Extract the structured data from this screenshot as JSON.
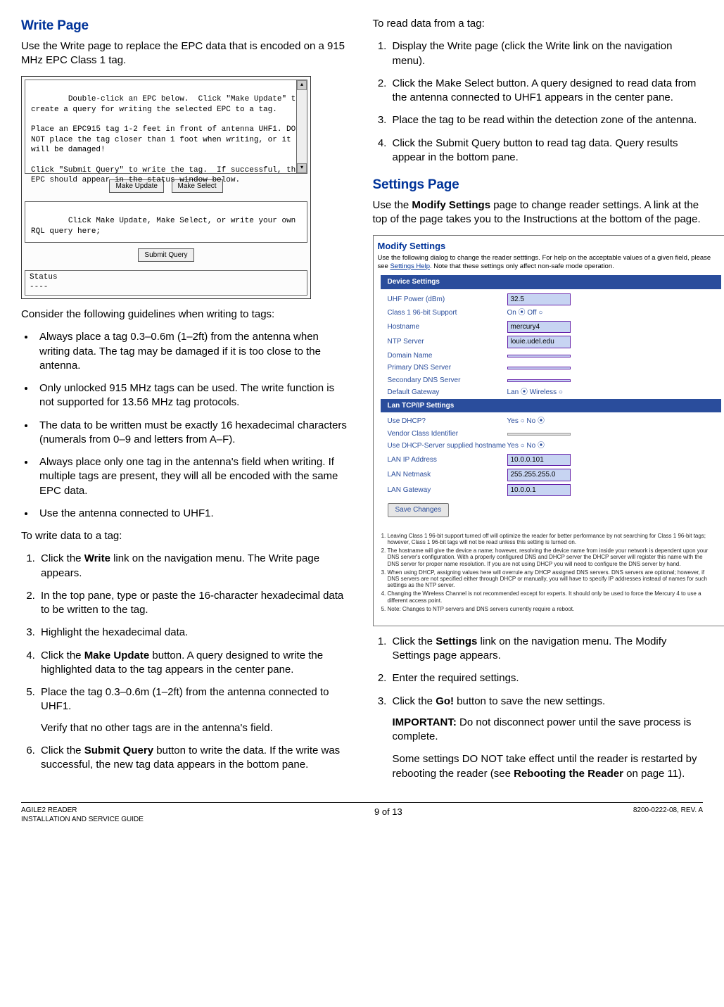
{
  "left": {
    "h_write": "Write Page",
    "intro_write": "Use the Write page to replace the EPC data that is encoded on a 915 MHz EPC Class 1 tag.",
    "fig1_top": "Double-click an EPC below.  Click \"Make Update\" to create a query for writing the selected EPC to a tag.\n\nPlace an EPC915 tag 1-2 feet in front of antenna UHF1. DO NOT place the tag closer than 1 foot when writing, or it will be damaged!\n\nClick \"Submit Query\" to write the tag.  If successful, the EPC should appear in the status window below.",
    "btn_make_update": "Make Update",
    "btn_make_select": "Make Select",
    "fig1_mid": "Click Make Update, Make Select, or write your own RQL query here;",
    "btn_submit_query": "Submit Query",
    "status_label": "Status",
    "status_dash": "----",
    "guidelines_intro": "Consider the following guidelines when writing to tags:",
    "bullets": [
      "Always place a tag 0.3–0.6m (1–2ft) from the antenna when writing data. The tag may be damaged if it is too close to the antenna.",
      "Only unlocked 915 MHz tags can be used. The write function is not supported for 13.56 MHz tag protocols.",
      "The data to be written must be exactly 16 hexadecimal characters (numerals from 0–9 and letters from A–F).",
      "Always place only one tag in the antenna's field when writing. If multiple tags are present, they will all be encoded with the same EPC data.",
      " Use the antenna connected to UHF1."
    ],
    "to_write_intro": "To write data to a tag:",
    "write_steps": [
      {
        "pre": "Click the ",
        "b": "Write",
        "post": " link on the navigation menu. The Write page appears."
      },
      {
        "pre": "In the top pane, type or paste the 16-character hexadecimal data to be written to the tag.",
        "b": "",
        "post": ""
      },
      {
        "pre": "Highlight the hexadecimal data.",
        "b": "",
        "post": ""
      },
      {
        "pre": "Click the ",
        "b": "Make Update",
        "post": " button. A query designed to write the highlighted data to the tag appears in the center pane."
      },
      {
        "pre": "Place the tag 0.3–0.6m (1–2ft) from the antenna connected to UHF1.",
        "b": "",
        "post": "",
        "sub": "Verify that no other tags are in the antenna's field."
      },
      {
        "pre": "Click the ",
        "b": "Submit Query",
        "post": " button to write the data. If the write was successful, the new tag data appears in the bottom pane."
      }
    ]
  },
  "right": {
    "read_intro": "To read data from a tag:",
    "read_steps": [
      "Display the Write page (click the Write link on the navigation menu).",
      "Click the Make Select button. A query designed to read data from the antenna connected to UHF1 appears in the center pane.",
      "Place the tag to be read within the detection zone of the antenna.",
      "Click the Submit Query button to read tag data. Query results appear in the bottom pane."
    ],
    "h_settings": "Settings Page",
    "settings_intro_pre": "Use the ",
    "settings_intro_b": "Modify Settings",
    "settings_intro_post": " page to change reader settings. A link at the top of the page takes you to the Instructions at the bottom of the page.",
    "fig2": {
      "title": "Modify Settings",
      "intro_a": "Use the following dialog to change the reader setttings. For help on the acceptable values of a given field, please see ",
      "intro_link": "Settings Help",
      "intro_b": ". Note that these settings only affect non-safe mode operation.",
      "hd_device": "Device Settings",
      "rows_device": [
        {
          "lab": "UHF Power (dBm)",
          "val": "32.5",
          "type": "input"
        },
        {
          "lab": "Class 1 96-bit Support",
          "val": "On ⦿ Off ○",
          "type": "radio"
        },
        {
          "lab": "Hostname",
          "val": "mercury4",
          "type": "input"
        },
        {
          "lab": "NTP Server",
          "val": "louie.udel.edu",
          "type": "input"
        },
        {
          "lab": "Domain Name",
          "val": "",
          "type": "input"
        },
        {
          "lab": "Primary DNS Server",
          "val": "",
          "type": "input"
        },
        {
          "lab": "Secondary DNS Server",
          "val": "",
          "type": "input"
        },
        {
          "lab": "Default Gateway",
          "val": "Lan ⦿  Wireless ○",
          "type": "radio"
        }
      ],
      "hd_lan": "Lan TCP/IP Settings",
      "rows_lan": [
        {
          "lab": "Use DHCP?",
          "val": "Yes ○  No ⦿",
          "type": "radio"
        },
        {
          "lab": "Vendor Class Identifier",
          "val": "",
          "type": "input-d"
        },
        {
          "lab": "Use DHCP-Server supplied hostname",
          "val": "Yes ○  No ⦿",
          "type": "radio"
        },
        {
          "lab": "LAN IP Address",
          "val": "10.0.0.101",
          "type": "input"
        },
        {
          "lab": "LAN Netmask",
          "val": "255.255.255.0",
          "type": "input"
        },
        {
          "lab": "LAN Gateway",
          "val": "10.0.0.1",
          "type": "input"
        }
      ],
      "save": "Save Changes",
      "notes": [
        "Leaving Class 1 96-bit support turned off will optimize the reader for better performance by not searching for Class 1 96-bit tags; however, Class 1 96-bit tags will not be read unless this setting is turned on.",
        "The hostname will give the device a name; however, resolving the device name from inside your network is dependent upon your DNS server's configuration. With a properly configured DNS and DHCP server the DHCP server will register this name with the DNS server for proper name resolution. If you are not using DHCP you will need to configure the DNS server by hand.",
        "When using DHCP, assigning values here will overrule any DHCP assigned DNS servers. DNS servers are optional; however, if DNS servers are not specified either through DHCP or manually, you will have to specify IP addresses instead of names for such settings as the NTP server.",
        "Changing the Wireless Channel is not recommended except for experts. It should only be used to force the Mercury 4 to use a different access point.",
        "Note: Changes to NTP servers and DNS servers currently require a reboot."
      ]
    },
    "settings_steps": [
      {
        "pre": "Click the ",
        "b": "Settings",
        "post": " link on the navigation menu. The Modify Settings page appears."
      },
      {
        "pre": "Enter the required settings.",
        "b": "",
        "post": ""
      },
      {
        "pre": "Click the ",
        "b": "Go!",
        "post": " button to save the new settings.",
        "s1b": "IMPORTANT:",
        "s1": " Do not disconnect power until the save process is complete.",
        "s2a": "Some settings DO NOT take effect until the reader is restarted by rebooting the reader (see ",
        "s2b": "Rebooting the Reader",
        "s2c": " on page 11)."
      }
    ]
  },
  "footer": {
    "left1": "AGILE2 READER",
    "left2": "INSTALLATION AND SERVICE GUIDE",
    "center": "9 of 13",
    "right": "8200-0222-08, REV. A"
  }
}
